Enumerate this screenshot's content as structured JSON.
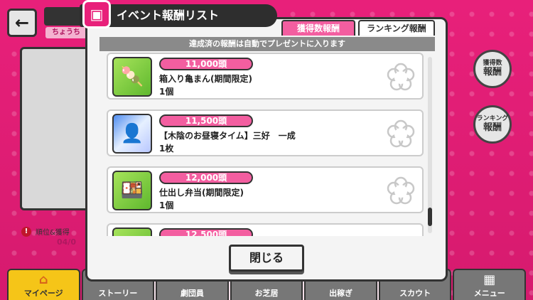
{
  "background": {
    "back_label": "←",
    "player_name": "ちょうち",
    "notice_text": "順位&獲得",
    "notice_icon": "!",
    "date_text": "04/0",
    "side_buttons": [
      {
        "line1": "獲得数",
        "line2": "報酬"
      },
      {
        "line1": "ランキング",
        "line2": "報酬"
      }
    ]
  },
  "bottom_nav": [
    {
      "label": "マイページ",
      "icon": "house-icon",
      "glyph": "⌂",
      "active": true
    },
    {
      "label": "ストーリー",
      "icon": "book-icon",
      "glyph": "",
      "active": false
    },
    {
      "label": "劇団員",
      "icon": "people-icon",
      "glyph": "",
      "active": false
    },
    {
      "label": "お芝居",
      "icon": "stage-icon",
      "glyph": "",
      "active": false
    },
    {
      "label": "出稼ぎ",
      "icon": "work-icon",
      "glyph": "",
      "active": false
    },
    {
      "label": "スカウト",
      "icon": "scout-icon",
      "glyph": "",
      "active": false
    },
    {
      "label": "メニュー",
      "icon": "grid-icon",
      "glyph": "▦",
      "active": false
    }
  ],
  "dialog": {
    "title": "イベント報酬リスト",
    "tabs": [
      "獲得数報酬",
      "ランキング報酬"
    ],
    "notice": "達成済の報酬は自動でプレゼントに入ります",
    "close_label": "閉じる",
    "items": [
      {
        "amount": "11,000頭",
        "name": "箱入り亀まん(期間限定)",
        "qty": "1個",
        "thumb": "green",
        "glyph": "🍡"
      },
      {
        "amount": "11,500頭",
        "name": "【木陰のお昼寝タイム】三好　一成",
        "qty": "1枚",
        "thumb": "chara",
        "glyph": "👤"
      },
      {
        "amount": "12,000頭",
        "name": "仕出し弁当(期間限定)",
        "qty": "1個",
        "thumb": "green",
        "glyph": "🍱"
      },
      {
        "amount": "12,500頭",
        "name": "",
        "qty": "",
        "thumb": "green",
        "glyph": ""
      }
    ]
  },
  "colors": {
    "accent_pink": "#f35ea0",
    "background_magenta": "#e8207a",
    "dark": "#2e2e2e"
  }
}
